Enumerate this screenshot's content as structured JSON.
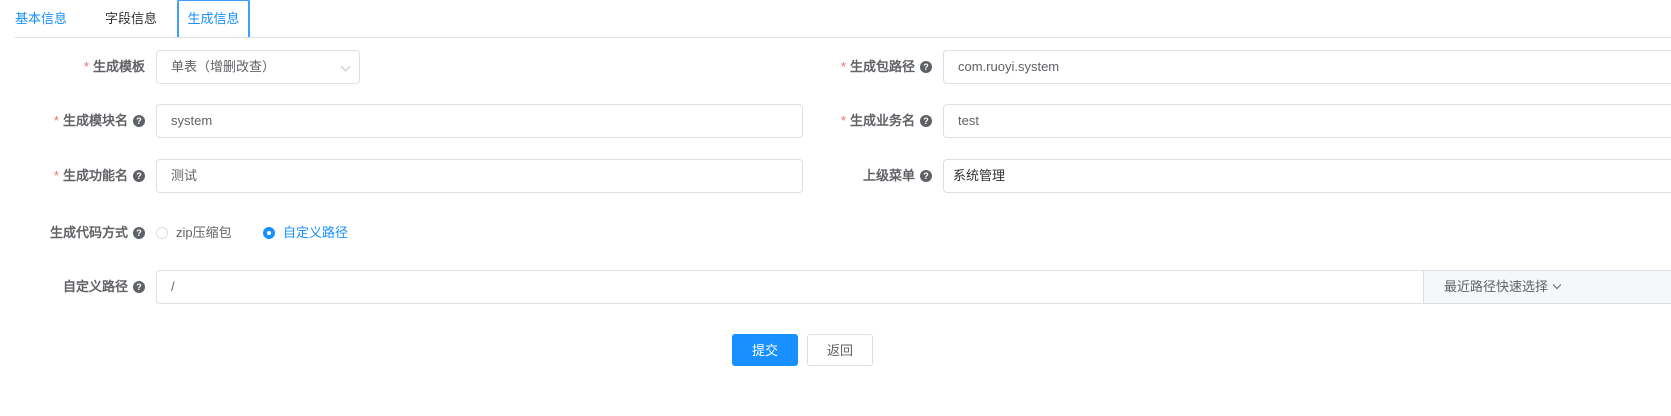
{
  "tabs": [
    {
      "label": "基本信息",
      "active": false
    },
    {
      "label": "字段信息",
      "active": false
    },
    {
      "label": "生成信息",
      "active": true
    }
  ],
  "form": {
    "tpl_category": {
      "label": "生成模板",
      "required": true,
      "value": "单表（增删改查）"
    },
    "package_name": {
      "label": "生成包路径",
      "required": true,
      "value": "com.ruoyi.system"
    },
    "module_name": {
      "label": "生成模块名",
      "required": true,
      "value": "system"
    },
    "business_name": {
      "label": "生成业务名",
      "required": true,
      "value": "test"
    },
    "function_name": {
      "label": "生成功能名",
      "required": true,
      "value": "测试"
    },
    "parent_menu": {
      "label": "上级菜单",
      "required": false,
      "value": "系统管理",
      "clear": "×"
    },
    "gen_type": {
      "label": "生成代码方式",
      "options": [
        "zip压缩包",
        "自定义路径"
      ],
      "selected": "自定义路径"
    },
    "gen_path": {
      "label": "自定义路径",
      "value": "/",
      "quick_select": "最近路径快速选择"
    }
  },
  "help_glyph": "?",
  "required_mark": "*",
  "actions": {
    "submit": "提交",
    "back": "返回"
  },
  "colors": {
    "primary": "#1890ff",
    "required": "#f56c6c",
    "border": "#dcdfe6"
  }
}
